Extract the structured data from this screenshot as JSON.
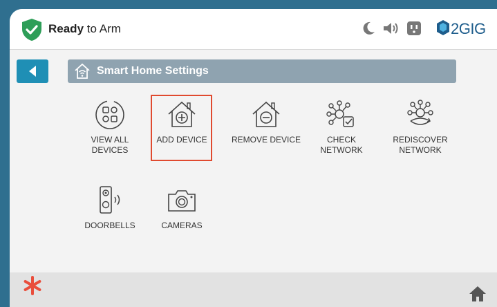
{
  "status": {
    "strong": "Ready",
    "rest": "to Arm"
  },
  "brand": {
    "name": "2GIG"
  },
  "header": {
    "title": "Smart Home Settings"
  },
  "tiles": [
    {
      "label_line1": "VIEW ALL",
      "label_line2": "DEVICES",
      "icon": "grid-apps-icon"
    },
    {
      "label_line1": "ADD DEVICE",
      "label_line2": "",
      "icon": "house-add-icon"
    },
    {
      "label_line1": "REMOVE DEVICE",
      "label_line2": "",
      "icon": "house-remove-icon"
    },
    {
      "label_line1": "CHECK",
      "label_line2": "NETWORK",
      "icon": "network-check-icon"
    },
    {
      "label_line1": "REDISCOVER",
      "label_line2": "NETWORK",
      "icon": "network-rediscover-icon"
    },
    {
      "label_line1": "DOORBELLS",
      "label_line2": "",
      "icon": "doorbell-icon"
    },
    {
      "label_line1": "CAMERAS",
      "label_line2": "",
      "icon": "camera-icon"
    }
  ],
  "colors": {
    "accent": "#1f8fb5",
    "ready_green": "#2e9e58",
    "highlight": "#e04a2f",
    "asterisk": "#e94e3c"
  }
}
